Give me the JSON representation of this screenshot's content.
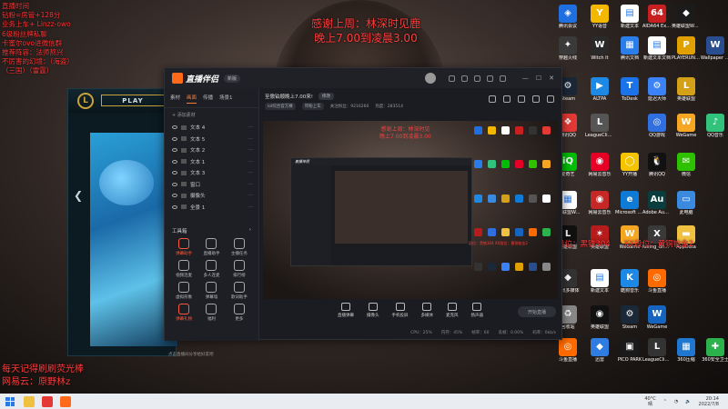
{
  "overlay": {
    "left_lines": [
      "直播时间",
      "钻粉=房管+128分",
      "业务上车+ Linzz-owo",
      "6级粉丝牌私聊",
      "卡蜜尔ovo进微信群",
      "推荐阵容：法师熬兴",
      "不厉害的幻境：（海盗）",
      "（三国）（雷霆）"
    ],
    "center_line1": "感谢上周：林深时见鹿",
    "center_line2": "晚上7.00到凌晨3.00",
    "bottom_line1": "每天记得刷刷荧光棒",
    "bottom_line2": "网易云：原野林z",
    "rank1": "段位：黑铁304",
    "rank2": "XX段位：黄铜铂金2"
  },
  "desktop_icons": [
    {
      "label": "腾讯会议",
      "color": "#1f6fe0",
      "glyph": "◈"
    },
    {
      "label": "YY语音",
      "color": "#f5b800",
      "glyph": "Y"
    },
    {
      "label": "新建文本",
      "color": "#ffffff",
      "glyph": "▤"
    },
    {
      "label": "AIDA64 Extreme",
      "color": "#c82020",
      "glyph": "64"
    },
    {
      "label": "英雄联盟WeGame版",
      "color": "#1b1b1b",
      "glyph": "◆"
    },
    {
      "label": "穿越火线",
      "color": "#3a3a3a",
      "glyph": "✦"
    },
    {
      "label": "Witch It",
      "color": "#2a2a2a",
      "glyph": "W"
    },
    {
      "label": "腾讯文档",
      "color": "#2b7de9",
      "glyph": "▦"
    },
    {
      "label": "新建文本文档",
      "color": "#ffffff",
      "glyph": "▤"
    },
    {
      "label": "PLAYERUNKNOWN BATTLEGR",
      "color": "#e0a000",
      "glyph": "P"
    },
    {
      "label": "Wallpaper Engine",
      "color": "#2a4d8f",
      "glyph": "W"
    },
    {
      "label": "Steam",
      "color": "#1b2838",
      "glyph": "⚙"
    },
    {
      "label": "ALTPA",
      "color": "#1e88e5",
      "glyph": "▶"
    },
    {
      "label": "ToDesk",
      "color": "#1a73e8",
      "glyph": "T"
    },
    {
      "label": "延迟大师",
      "color": "#3b82f6",
      "glyph": "⚙"
    },
    {
      "label": "英雄联盟",
      "color": "#d4a017",
      "glyph": "L"
    },
    {
      "label": "腾讯QQ",
      "color": "#e53935",
      "glyph": "❖"
    },
    {
      "label": "LeagueClient",
      "color": "#555555",
      "glyph": "L"
    },
    {
      "label": "QQ游戏",
      "color": "#2f6fe0",
      "glyph": "◎"
    },
    {
      "label": "WeGame",
      "color": "#f5a623",
      "glyph": "W"
    },
    {
      "label": "QQ音乐",
      "color": "#31c27c",
      "glyph": "♪"
    },
    {
      "label": "爱奇艺",
      "color": "#00be06",
      "glyph": "iQ"
    },
    {
      "label": "网易云音乐",
      "color": "#e60026",
      "glyph": "◉"
    },
    {
      "label": "YY开播",
      "color": "#f5c400",
      "glyph": "◯"
    },
    {
      "label": "腾讯QQ",
      "color": "#111111",
      "glyph": "🐧"
    },
    {
      "label": "微信",
      "color": "#2dc100",
      "glyph": "✉"
    },
    {
      "label": "英雄联盟WeGame",
      "color": "#ffffff",
      "glyph": "▦"
    },
    {
      "label": "网易云音乐",
      "color": "#c62828",
      "glyph": "◉"
    },
    {
      "label": "Microsoft Edge",
      "color": "#0f7bd6",
      "glyph": "e"
    },
    {
      "label": "Adobe Audition",
      "color": "#0a3d3d",
      "glyph": "Au"
    },
    {
      "label": "此电脑",
      "color": "#3a8be0",
      "glyph": "▭"
    },
    {
      "label": "英雄联盟",
      "color": "#111111",
      "glyph": "L"
    },
    {
      "label": "英雄联盟",
      "color": "#b71c1c",
      "glyph": "✶"
    },
    {
      "label": "WeGame",
      "color": "#f5a623",
      "glyph": "W"
    },
    {
      "label": "luxing_driver",
      "color": "#3a3a3a",
      "glyph": "X"
    },
    {
      "label": "AppData",
      "color": "#f0c040",
      "glyph": "▬"
    },
    {
      "label": "腾讯多媒体",
      "color": "#333333",
      "glyph": "◆"
    },
    {
      "label": "新建文本",
      "color": "#ffffff",
      "glyph": "▤"
    },
    {
      "label": "酷狗音乐",
      "color": "#1e88e5",
      "glyph": "K"
    },
    {
      "label": "斗鱼直播",
      "color": "#ff6a00",
      "glyph": "◎"
    },
    {
      "label": "回收站",
      "color": "#888888",
      "glyph": "♻"
    },
    {
      "label": "英雄联盟",
      "color": "#111111",
      "glyph": "◉"
    },
    {
      "label": "Steam",
      "color": "#1b2838",
      "glyph": "⚙"
    },
    {
      "label": "WeGame",
      "color": "#1565c0",
      "glyph": "W"
    },
    {
      "label": "斗鱼直播",
      "color": "#ff6a00",
      "glyph": "◎"
    },
    {
      "label": "迅雷",
      "color": "#2f7de0",
      "glyph": "◆"
    },
    {
      "label": "PICO PARK",
      "color": "#1a1a1a",
      "glyph": "▣"
    },
    {
      "label": "LeagueClient",
      "color": "#333333",
      "glyph": "L"
    },
    {
      "label": "360压缩",
      "color": "#1f77d0",
      "glyph": "▦"
    },
    {
      "label": "360安全卫士",
      "color": "#2bb24c",
      "glyph": "✚"
    }
  ],
  "game": {
    "play_label": "PLAY",
    "logo": "L",
    "arrow": "❮"
  },
  "app": {
    "name": "直播伴侣",
    "version": "新版",
    "left_tabs": [
      "素材",
      "画面",
      "传播",
      "场景1"
    ],
    "add_scene": "+ 添加素材",
    "scenes": [
      "文本 4",
      "文本 5",
      "文本 2",
      "文本 1",
      "文本 3",
      "窗口",
      "摄像头",
      "全景 1"
    ],
    "tools_label": "工具箱",
    "tools_more": "›",
    "tools": [
      {
        "label": "弹幕助手",
        "hot": true
      },
      {
        "label": "直播助手",
        "hot": false
      },
      {
        "label": "主播任务",
        "hot": false
      },
      {
        "label": "视频连麦",
        "hot": false
      },
      {
        "label": "多人连麦",
        "hot": false
      },
      {
        "label": "排行榜",
        "hot": false
      },
      {
        "label": "虚拟形象",
        "hot": false
      },
      {
        "label": "弹幕墙",
        "hot": false
      },
      {
        "label": "歌词助手",
        "hot": false
      },
      {
        "label": "弹幕礼物",
        "hot": true
      },
      {
        "label": "福利",
        "hot": false
      },
      {
        "label": "更多",
        "hot": false
      }
    ],
    "stream_title": "至傲铂顺晚上7.00来!",
    "edit_btn": "修改",
    "meta_chip1": "lol综合官方赛",
    "meta_chip2": "带粉上车",
    "meta_followers": "关注粉丝：9216260",
    "meta_hot": "热度：283514",
    "preview_text1": "感谢上周：林深时见",
    "preview_text2": "晚上7.00到凌晨3.00",
    "preview_rank": "段位：黑铁304    XX段位：黄铜铂金2",
    "preview_app_name": "直播伴侣",
    "bottom_controls": [
      "直播弹幕",
      "摄像头",
      "手机投屏",
      "多媒体",
      "麦克风",
      "扬声器"
    ],
    "start_live": "开始直播",
    "status_items": [
      "CPU：25%",
      "内存：45%",
      "帧率：60",
      "丢帧：0.00%",
      "码率：0kb/s"
    ],
    "left_bottom": "点击直播间分享给好友吧"
  },
  "taskbar": {
    "weather_temp": "40°C",
    "weather_desc": "晴",
    "time": "20:14",
    "date": "2022/7/8"
  },
  "preview_icon_colors": [
    "#1f6fe0",
    "#f5b800",
    "#ffffff",
    "#c82020",
    "#333333",
    "#e53935",
    "#2b7de9",
    "#31c27c",
    "#00be06",
    "#e60026",
    "#2dc100",
    "#f5a623",
    "#1e88e5",
    "#3a8be0",
    "#d4a017",
    "#0f7bd6",
    "#555555",
    "#ffffff",
    "#b71c1c",
    "#2f6fe0",
    "#f0c040",
    "#1565c0",
    "#ff6a00",
    "#2bb24c",
    "#333333",
    "#1b2838",
    "#3b82f6",
    "#e0a000",
    "#2a4d8f",
    "#888888"
  ]
}
